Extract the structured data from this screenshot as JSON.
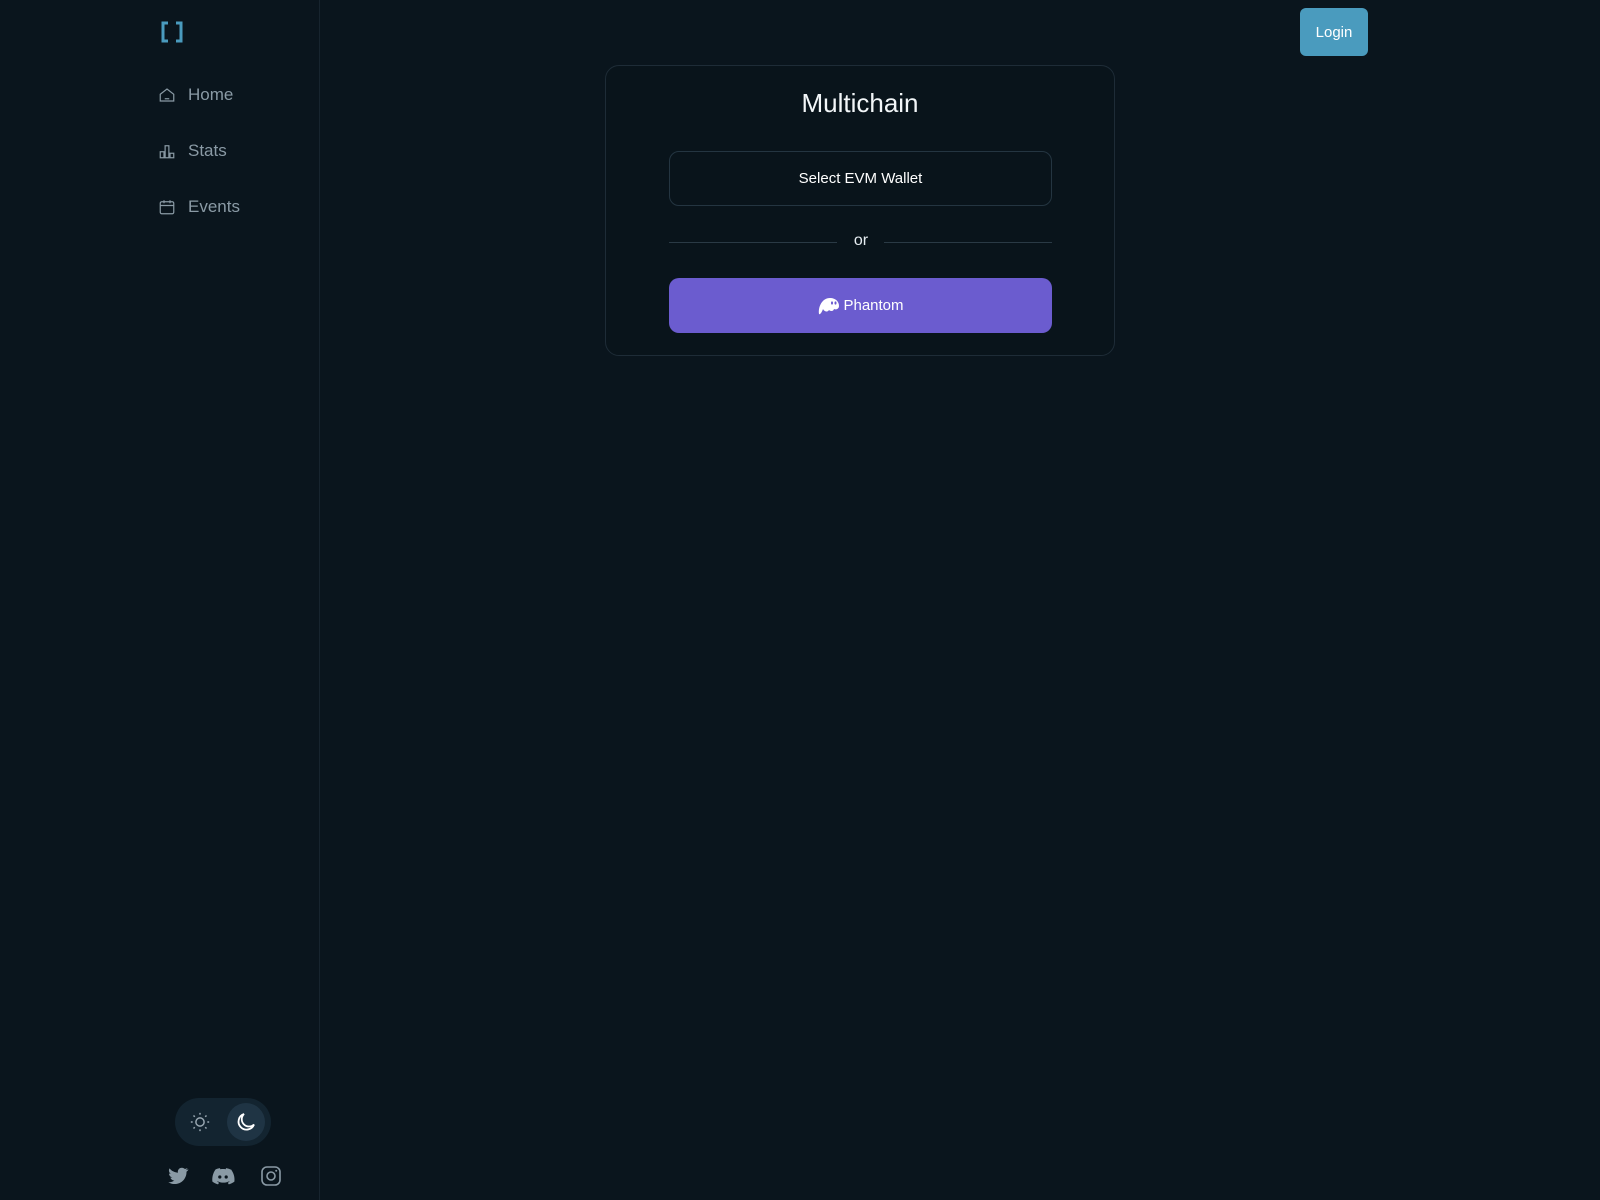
{
  "sidebar": {
    "logo_icon": "bracket-logo-icon",
    "items": [
      {
        "label": "Home",
        "icon": "home-icon"
      },
      {
        "label": "Stats",
        "icon": "stats-icon"
      },
      {
        "label": "Events",
        "icon": "calendar-icon"
      }
    ],
    "theme": {
      "light_icon": "sun-icon",
      "dark_icon": "moon-icon",
      "selected": "dark"
    },
    "social": [
      "twitter-icon",
      "discord-icon",
      "instagram-icon"
    ]
  },
  "header": {
    "login_label": "Login"
  },
  "wallet_card": {
    "title": "Multichain",
    "evm_button_label": "Select EVM Wallet",
    "divider_text": "or",
    "phantom_button_label": "Phantom",
    "phantom_icon": "phantom-ghost-icon"
  },
  "colors": {
    "background": "#0a151d",
    "accent": "#4a9bbe",
    "phantom": "#6b5ccf",
    "muted_text": "#8a9aa5"
  }
}
